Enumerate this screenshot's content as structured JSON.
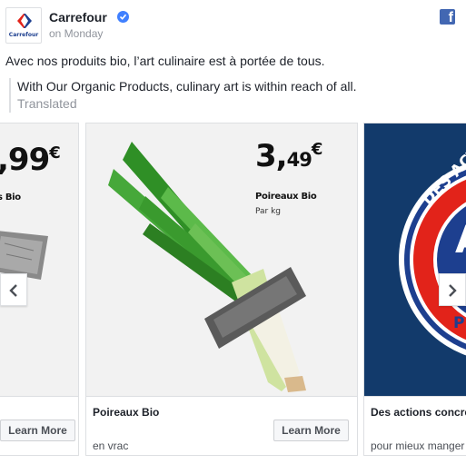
{
  "post": {
    "page_name": "Carrefour",
    "time": "on Monday",
    "avatar_text": "Carrefour",
    "text": "Avec nos produits bio, l’art culinaire est à portée de tous.",
    "translation": "With Our Organic Products, culinary art is within reach of all.",
    "translated_label": "Translated"
  },
  "icons": {
    "verified": "verified-badge-icon",
    "facebook": "facebook-icon",
    "prev": "chevron-left-icon",
    "next": "chevron-right-icon"
  },
  "colors": {
    "facebook_blue": "#4267b2",
    "verified_blue": "#4080ff",
    "leek_green": "#3c9b2c",
    "blue_card": "#123a6b"
  },
  "cards": [
    {
      "price_main": ",99",
      "price_euro": "€",
      "product": "s Bio",
      "cta": "Learn More"
    },
    {
      "price_main": "3,",
      "price_cents": "49",
      "price_euro": "€",
      "product": "Poireaux Bio",
      "unit": "Par kg",
      "title": "Poireaux Bio",
      "description": "en vrac",
      "cta": "Learn More"
    },
    {
      "badge_top": "DES ACTION",
      "badge_letter": "A",
      "badge_bottom": "P",
      "title": "Des actions concre",
      "description": "pour mieux manger"
    }
  ]
}
